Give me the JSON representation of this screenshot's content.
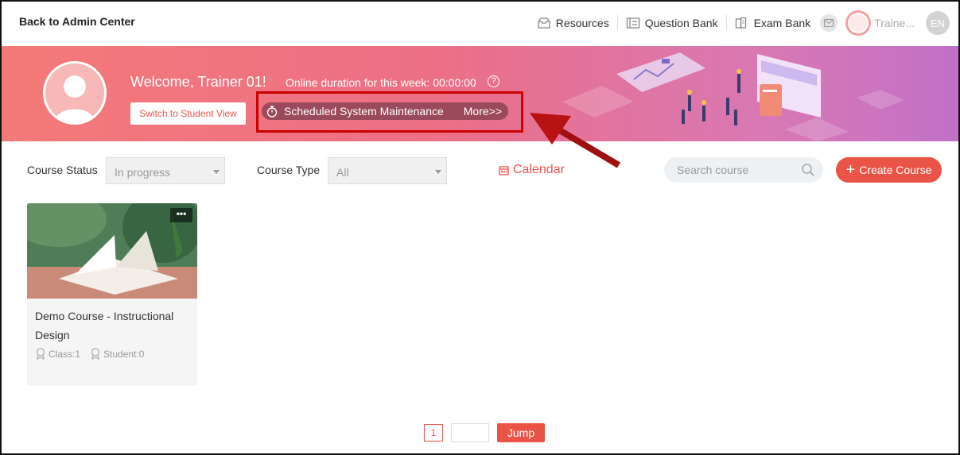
{
  "header": {
    "back_label": "Back to Admin Center",
    "nav": [
      {
        "label": "Resources",
        "icon": "resources-icon"
      },
      {
        "label": "Question Bank",
        "icon": "question-bank-icon"
      },
      {
        "label": "Exam Bank",
        "icon": "exam-bank-icon"
      }
    ],
    "user_name": "Traine...",
    "language": "EN"
  },
  "banner": {
    "welcome": "Welcome, Trainer 01!",
    "online_duration": "Online duration for this week: 00:00:00",
    "help": "?",
    "switch_label": "Switch to Student View",
    "notice_text": "Scheduled System Maintenance",
    "notice_more": "More>>"
  },
  "filters": {
    "status_label": "Course Status",
    "status_value": "In progress",
    "type_label": "Course Type",
    "type_value": "All",
    "calendar_label": "Calendar",
    "search_placeholder": "Search course",
    "create_label": "Create Course"
  },
  "courses": [
    {
      "title": "Demo Course - Instructional Design",
      "more": "•••",
      "class_count": "Class:1",
      "student_count": "Student:0"
    }
  ],
  "pagination": {
    "current_page": "1",
    "jump_label": "Jump"
  },
  "colors": {
    "accent": "#ea5447",
    "banner_start": "#f47a78",
    "banner_end": "#c170c8",
    "annotation": "#cc0000"
  }
}
